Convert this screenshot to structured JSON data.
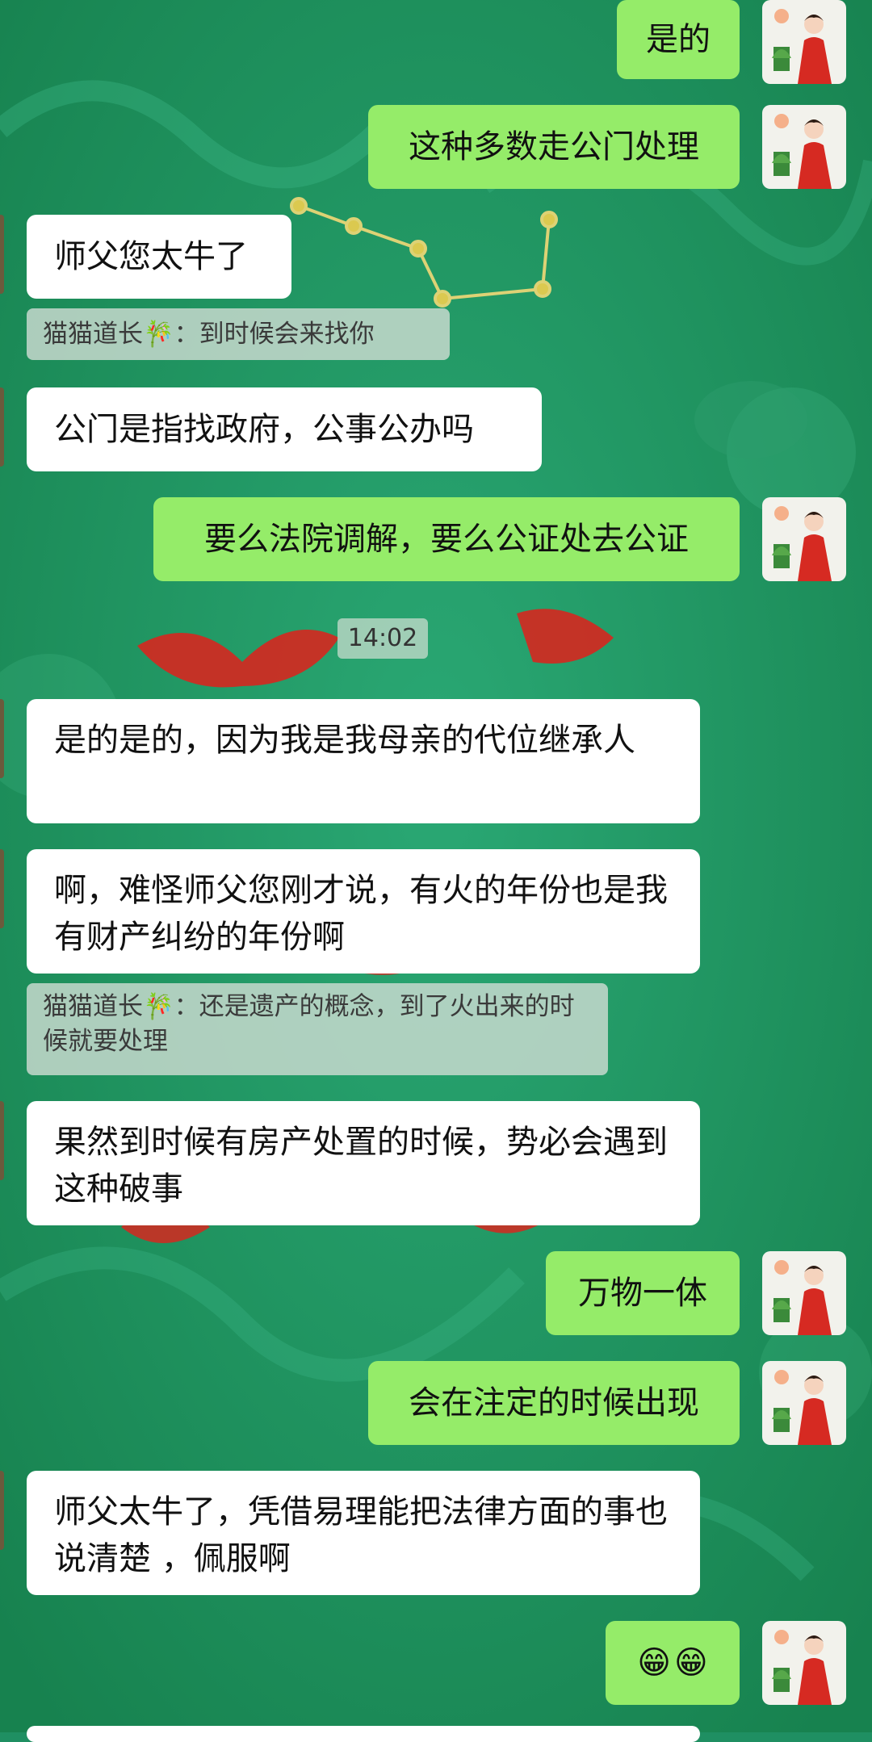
{
  "chat": {
    "messages": [
      {
        "side": "out",
        "text": "是的"
      },
      {
        "side": "out",
        "text": "这种多数走公门处理"
      },
      {
        "side": "in",
        "text": "师父您太牛了"
      },
      {
        "side": "in",
        "text": "公门是指找政府，公事公办吗"
      },
      {
        "side": "out",
        "text": "要么法院调解，要么公证处去公证"
      },
      {
        "side": "in",
        "text": "是的是的，因为我是我母亲的代位继承人"
      },
      {
        "side": "in",
        "text": "啊，难怪师父您刚才说，有火的年份也是我有财产纠纷的年份啊"
      },
      {
        "side": "in",
        "text": "果然到时候有房产处置的时候，势必会遇到这种破事"
      },
      {
        "side": "out",
        "text": "万物一体"
      },
      {
        "side": "out",
        "text": "会在注定的时候出现"
      },
      {
        "side": "in",
        "text": "师父太牛了，凭借易理能把法律方面的事也说清楚 ，佩服啊"
      },
      {
        "side": "out",
        "emoji": [
          "😁",
          "😁"
        ]
      }
    ],
    "quotes": [
      {
        "text": "猫猫道长🎋：到时候会来找你"
      },
      {
        "text": "猫猫道长🎋：还是遗产的概念，到了火出来的时候就要处理"
      }
    ],
    "timestamp": "14:02",
    "colors": {
      "outgoing": "#95ec69",
      "incoming": "#ffffff",
      "background": "#1f8f62"
    },
    "icons": {
      "avatar": "avatar-woman-red-dress",
      "emoji": "grinning-face-icon"
    }
  }
}
